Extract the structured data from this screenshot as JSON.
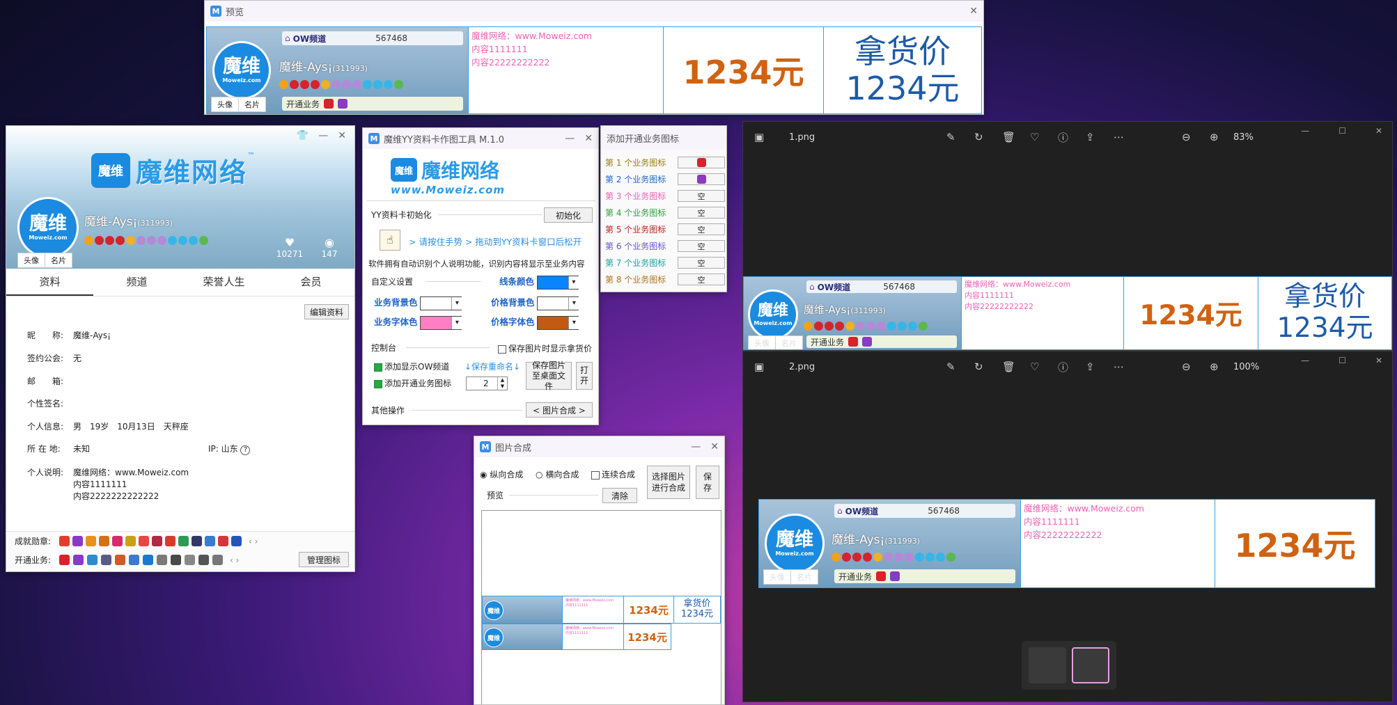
{
  "card": {
    "channel_label": "OW频道",
    "channel_num": "567468",
    "name": "魔维-Ays¡",
    "uid": "(311993)",
    "avatar_big": "魔维",
    "avatar_small": "Moweiz.com",
    "btn_avatar": "头像",
    "btn_card": "名片",
    "biz_label": "开通业务",
    "desc": [
      "魔维网络：www.Moweiz.com",
      "内容1111111",
      "内容22222222222"
    ],
    "price": "1234元",
    "name_price_label": "拿货价",
    "name_price_value": "1234元"
  },
  "preview_win": {
    "title": "预览"
  },
  "profile_win": {
    "brand": "魔维网络",
    "brand_tm": "™",
    "likes": "10271",
    "followers": "147",
    "tabs": [
      "资料",
      "频道",
      "荣誉人生",
      "会员"
    ],
    "edit_btn": "编辑资料",
    "rows": [
      {
        "label": "昵　　称:",
        "value": "魔维-Ays¡"
      },
      {
        "label": "签约公会:",
        "value": "无"
      },
      {
        "label": "邮　　箱:",
        "value": ""
      },
      {
        "label": "个性签名:",
        "value": ""
      },
      {
        "label": "个人信息:",
        "value": "男　19岁　10月13日　天秤座"
      },
      {
        "label": "所 在 地:",
        "value": "未知"
      }
    ],
    "ip": "IP: 山东",
    "desc_label": "个人说明:",
    "desc": [
      "魔维网络：www.Moweiz.com",
      "内容1111111",
      "内容2222222222222"
    ],
    "medals_label": "成就勋章:",
    "biz_label": "开通业务:",
    "manage_btn": "管理图标"
  },
  "tool_win": {
    "title": "魔维YY资料卡作图工具 M.1.0",
    "logo_text": "魔维网络",
    "logo_url": "www.Moweiz.com",
    "init_section": "YY资料卡初始化",
    "init_btn": "初始化",
    "drag_hint": "> 请按住手势 > 拖动到YY资料卡窗口后松开",
    "auto_text": "软件拥有自动识别个人说明功能，识别内容将显示至业务内容",
    "custom_section": "自定义设置",
    "line_color": "线条颜色",
    "biz_bg": "业务背景色",
    "price_bg": "价格背景色",
    "biz_font": "业务字体色",
    "price_font": "价格字体色",
    "console_section": "控制台",
    "save_show_price": "保存图片时显示拿货价",
    "add_ow": "添加显示OW频道",
    "save_rename": "↓保存重命名↓",
    "add_biz_icons": "添加开通业务图标",
    "spin_value": "2",
    "save_desktop": "保存图片至桌面文件",
    "open_btn": "打开",
    "other_section": "其他操作",
    "compose_btn": "< 图片合成 >"
  },
  "service_win": {
    "title": "添加开通业务图标",
    "items": [
      {
        "label": "第 1 个业务图标",
        "value": "",
        "color": "#9a7a12"
      },
      {
        "label": "第 2 个业务图标",
        "value": "",
        "color": "#1f63c9"
      },
      {
        "label": "第 3 个业务图标",
        "value": "空",
        "color": "#ee60b7"
      },
      {
        "label": "第 4 个业务图标",
        "value": "空",
        "color": "#2e9d3c"
      },
      {
        "label": "第 5 个业务图标",
        "value": "空",
        "color": "#c01d1d"
      },
      {
        "label": "第 6 个业务图标",
        "value": "空",
        "color": "#6a52d4"
      },
      {
        "label": "第 7 个业务图标",
        "value": "空",
        "color": "#1aa0a6"
      },
      {
        "label": "第 8 个业务图标",
        "value": "空",
        "color": "#b26f1b"
      }
    ]
  },
  "compose_win": {
    "title": "图片合成",
    "vertical": "纵向合成",
    "horizontal": "横向合成",
    "continuous": "连续合成",
    "select_btn": "选择图片进行合成",
    "save_btn": "保存",
    "preview_label": "预览",
    "clear_btn": "清除"
  },
  "photo1": {
    "title": "1.png",
    "zoom": "83%"
  },
  "photo2": {
    "title": "2.png",
    "zoom": "100%"
  },
  "colors": {
    "line": "#0a84ff",
    "price_bg": "#ffffff",
    "biz_font": "#ff7fc4",
    "price_font": "#c25a12",
    "accent": "#1a8be0"
  }
}
